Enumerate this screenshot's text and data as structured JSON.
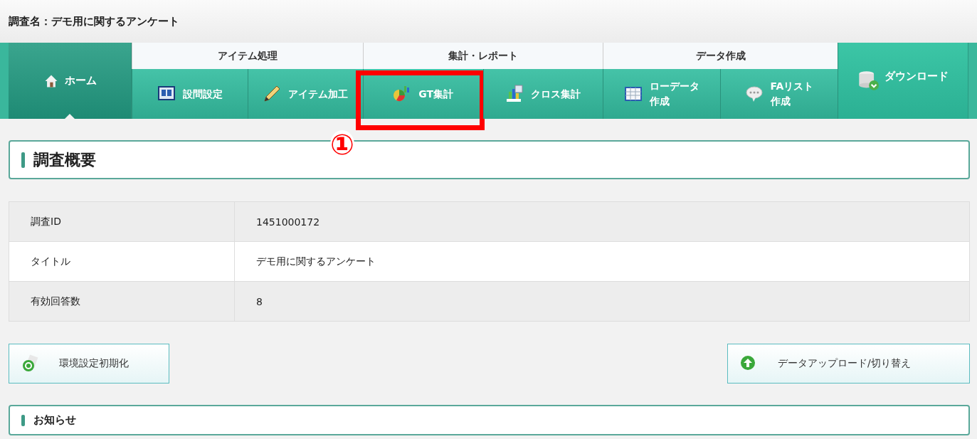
{
  "survey_name": "調査名：デモ用に関するアンケート",
  "nav": {
    "home": {
      "label": "ホーム",
      "selected": true
    },
    "groups": [
      {
        "title": "アイテム処理",
        "items": [
          {
            "lines": [
              "設問設定"
            ],
            "highlighted": false
          },
          {
            "lines": [
              "アイテム加工"
            ],
            "highlighted": false
          }
        ]
      },
      {
        "title": "集計・レポート",
        "items": [
          {
            "lines": [
              "GT集計"
            ],
            "highlighted": true
          },
          {
            "lines": [
              "クロス集計"
            ],
            "highlighted": false
          }
        ]
      },
      {
        "title": "データ作成",
        "items": [
          {
            "lines": [
              "ローデータ",
              "作成"
            ],
            "highlighted": false
          },
          {
            "lines": [
              "FAリスト",
              "作成"
            ],
            "highlighted": false
          }
        ]
      }
    ],
    "download": {
      "label": "ダウンロード"
    }
  },
  "annotation": {
    "label": "①"
  },
  "overview": {
    "title": "調査概要",
    "rows": [
      {
        "label": "調査ID",
        "value": "1451000172"
      },
      {
        "label": "タイトル",
        "value": "デモ用に関するアンケート"
      },
      {
        "label": "有効回答数",
        "value": "8"
      }
    ]
  },
  "buttons": [
    {
      "label": "環境設定初期化",
      "kind": "reset"
    },
    {
      "label": "データアップロード/切り替え",
      "kind": "upload"
    }
  ],
  "notice": {
    "title": "お知らせ"
  }
}
